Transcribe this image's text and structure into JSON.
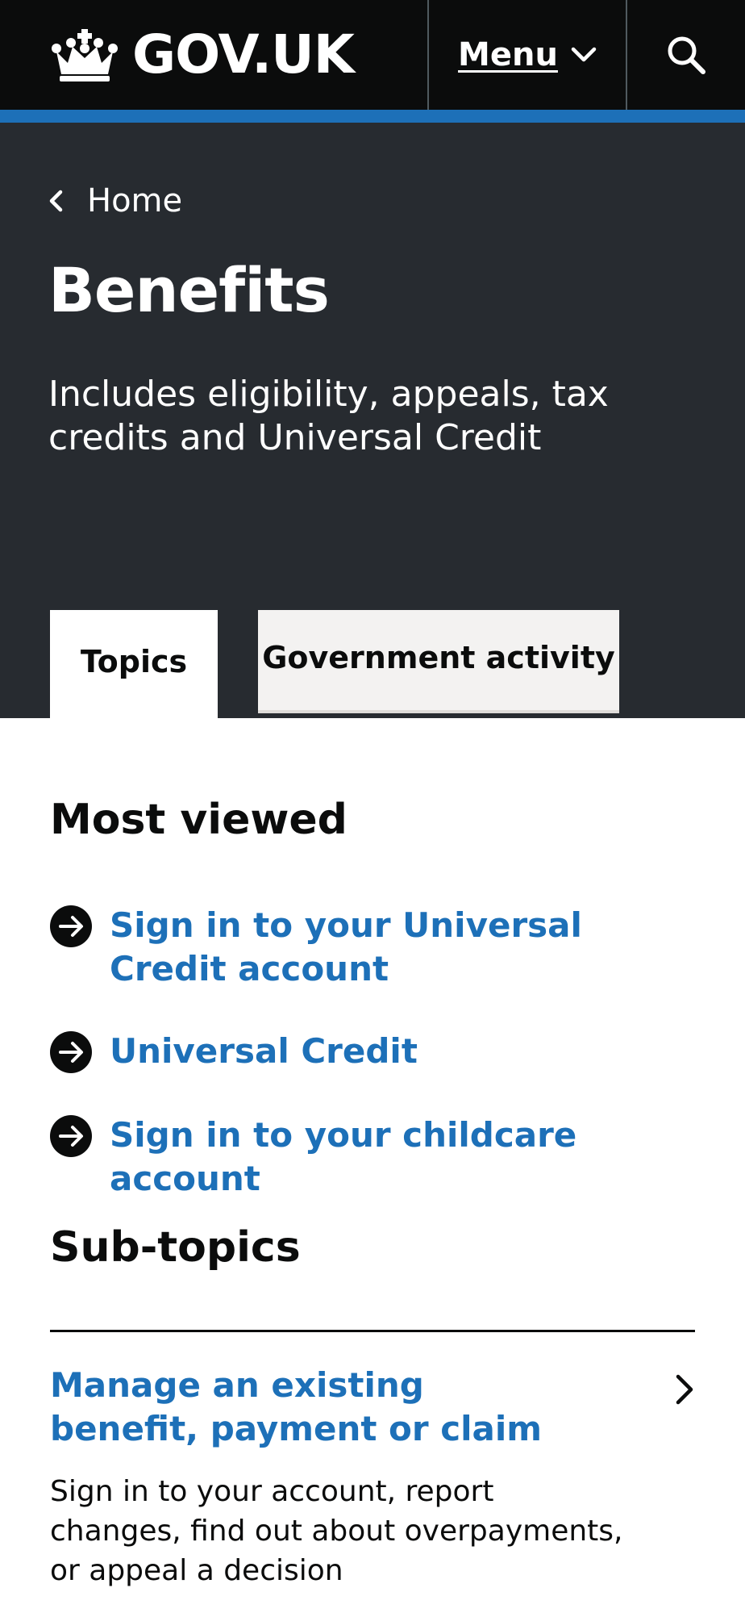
{
  "header": {
    "logo_text": "GOV.UK",
    "menu_label": "Menu",
    "colors": {
      "background": "#0b0c0c",
      "accent_bar": "#1d70b8"
    },
    "icons": {
      "logo": "crown-icon",
      "menu": "chevron-down-icon",
      "search": "search-icon"
    }
  },
  "hero": {
    "breadcrumb": {
      "label": "Home",
      "icon": "chevron-left-icon"
    },
    "title": "Benefits",
    "description": "Includes eligibility, appeals, tax credits and Universal Credit",
    "colors": {
      "background": "#272b30"
    }
  },
  "tabs": [
    {
      "label": "Topics",
      "active": true
    },
    {
      "label": "Government activity",
      "active": false
    }
  ],
  "most_viewed": {
    "heading": "Most viewed",
    "items": [
      {
        "label": "Sign in to your Universal Credit account",
        "icon": "arrow-right-circle-icon"
      },
      {
        "label": "Universal Credit",
        "icon": "arrow-right-circle-icon"
      },
      {
        "label": "Sign in to your childcare account",
        "icon": "arrow-right-circle-icon"
      }
    ],
    "colors": {
      "link": "#1d70b8"
    }
  },
  "sub_topics": {
    "heading": "Sub-topics",
    "items": [
      {
        "title": "Manage an existing benefit, payment or claim",
        "description": "Sign in to your account, report changes, find out about overpayments, or appeal a decision",
        "icon": "chevron-right-icon"
      }
    ]
  }
}
